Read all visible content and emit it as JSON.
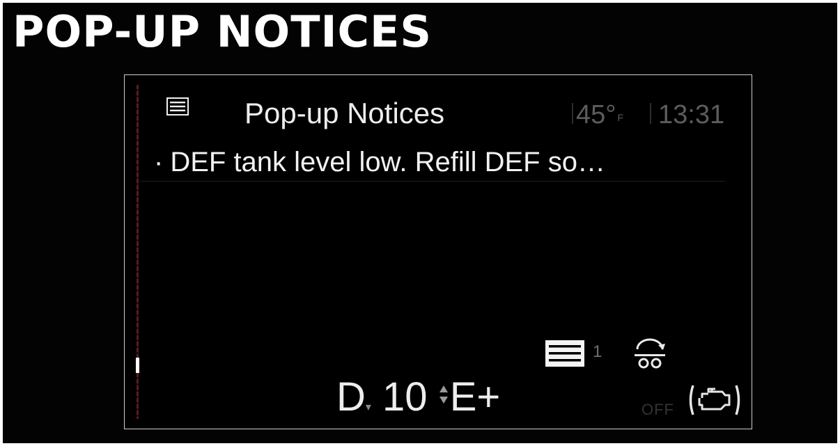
{
  "heading": "POP-UP NOTICES",
  "screen": {
    "title": "Pop-up Notices",
    "temperature": "45°",
    "temperature_unit": "F",
    "time": "13:31",
    "notice": "DEF tank level low. Refill DEF so…",
    "notice_bullet": "·",
    "notification_count": "1",
    "gear": "D",
    "gear_down_arrow": "▾",
    "gear_number": "10",
    "eco_mode": "E+",
    "start_stop_status": "OFF",
    "icons": [
      "menu-list-icon",
      "notification-list-icon",
      "tire-pressure-icon",
      "engine-icon"
    ]
  }
}
